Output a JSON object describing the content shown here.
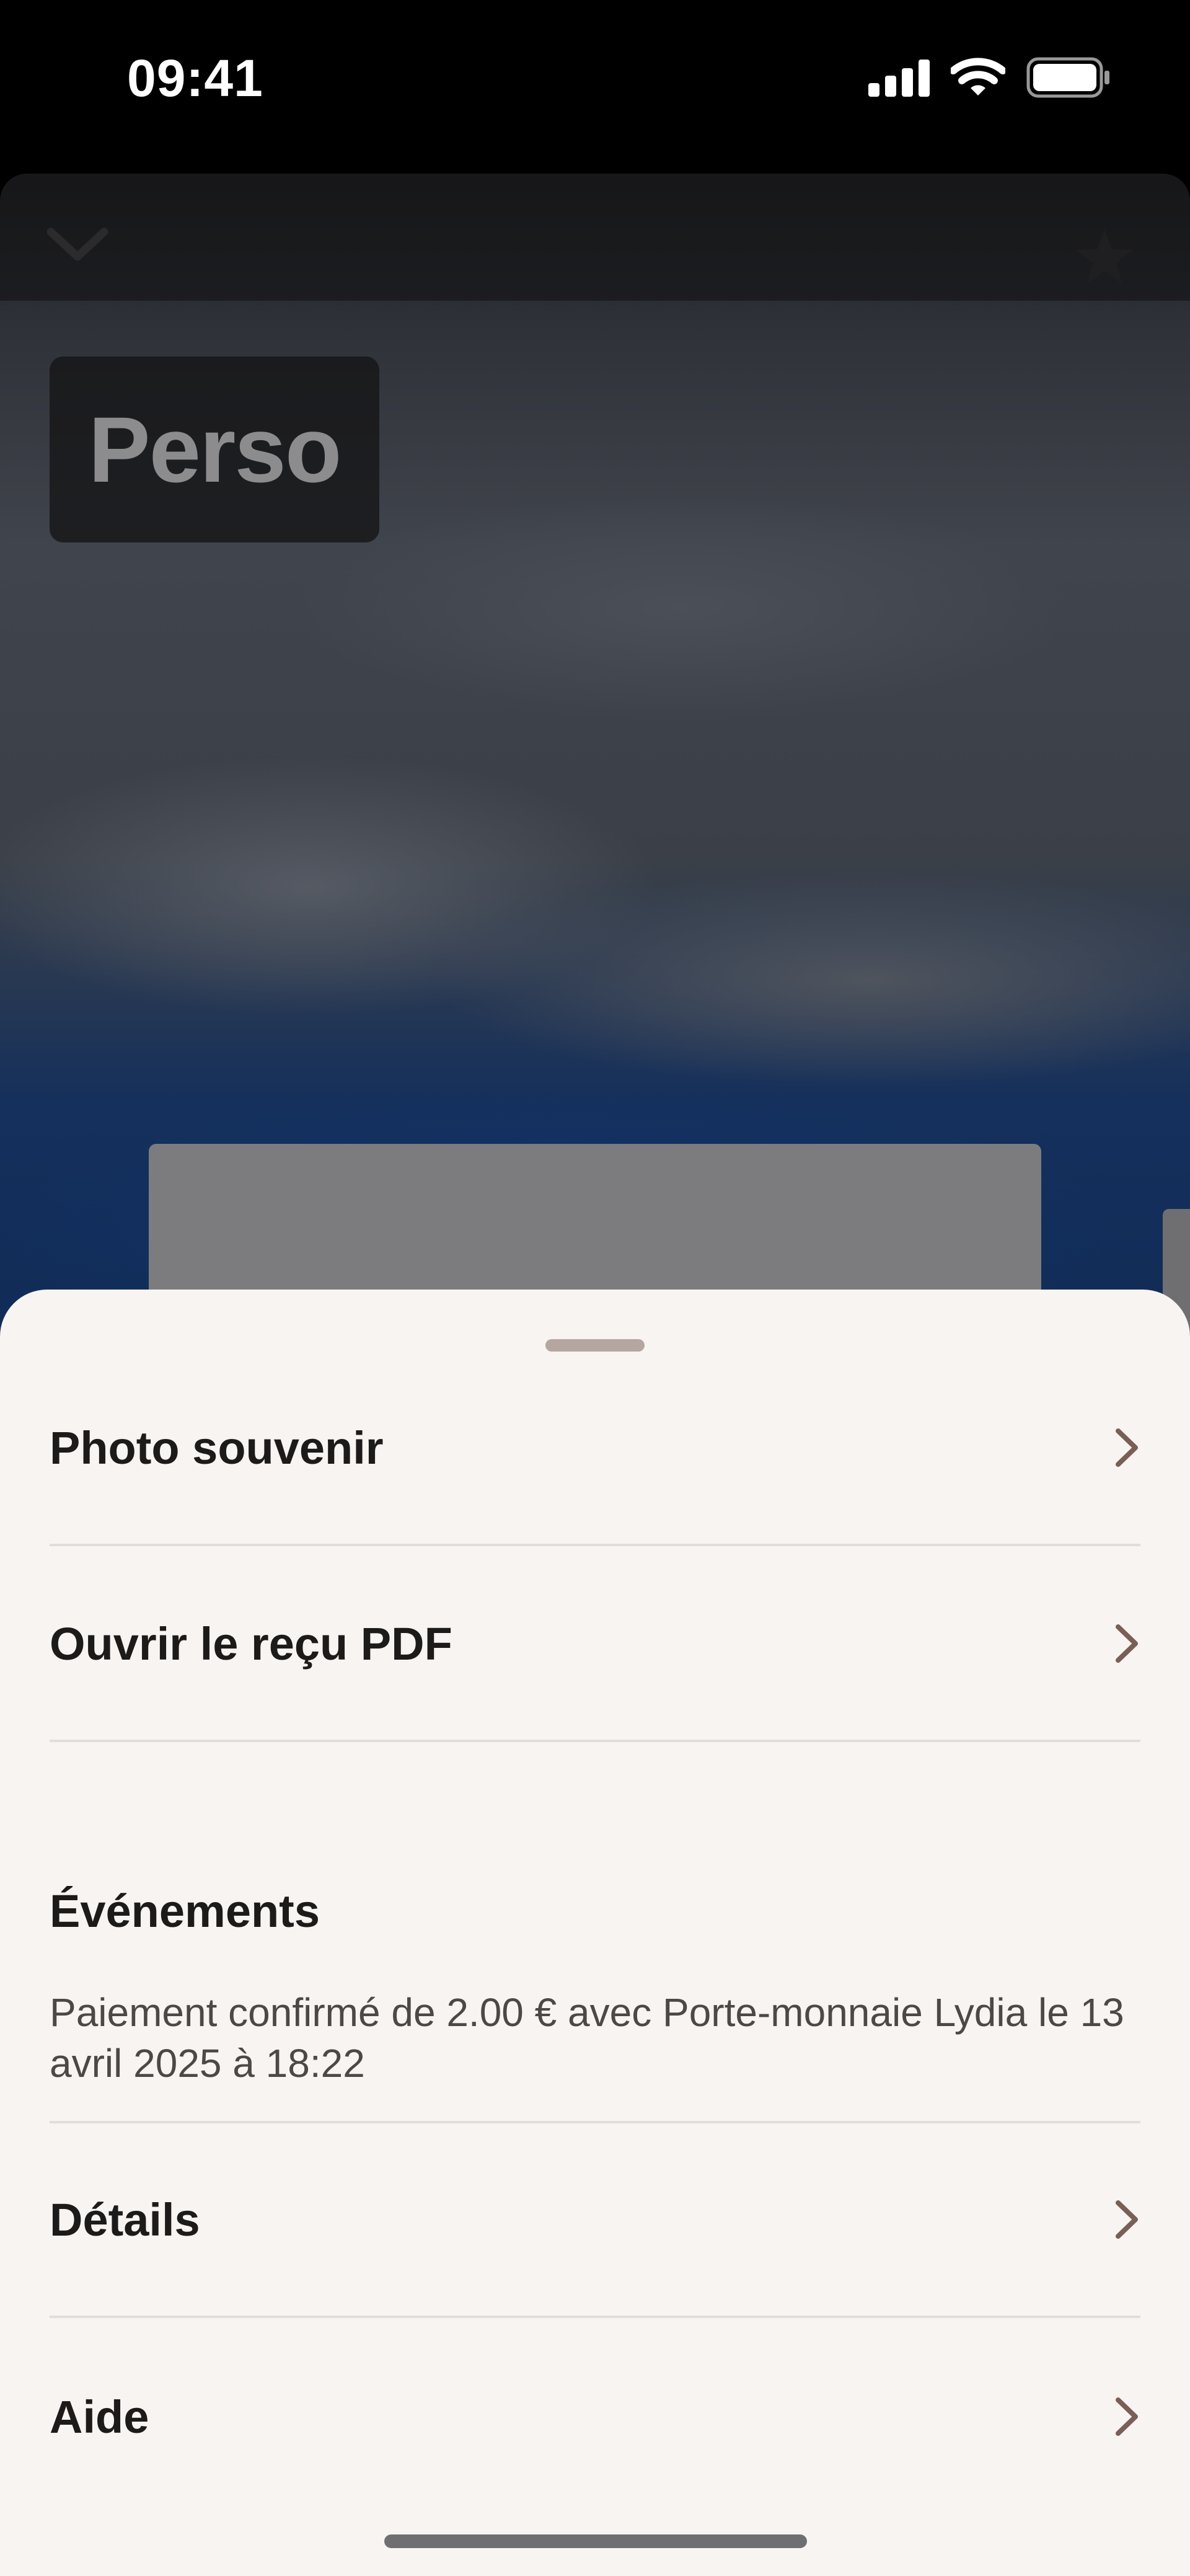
{
  "status_bar": {
    "time": "09:41",
    "icons": [
      "signal-icon",
      "wifi-icon",
      "battery-icon"
    ]
  },
  "background": {
    "tag": "Perso",
    "icons": [
      "chevron-down-icon",
      "star-icon"
    ]
  },
  "sheet": {
    "rows": [
      {
        "label": "Photo souvenir"
      },
      {
        "label": "Ouvrir le reçu PDF"
      },
      {
        "label": "Détails"
      },
      {
        "label": "Aide"
      }
    ],
    "events": {
      "title": "Événements",
      "text": "Paiement confirmé de 2.00 € avec Porte-monnaie Lydia le 13 avril 2025 à 18:22"
    }
  },
  "colors": {
    "sheet_bg": "#f7f4f2",
    "chevron": "#7a5f57",
    "divider": "#e2dddb"
  }
}
